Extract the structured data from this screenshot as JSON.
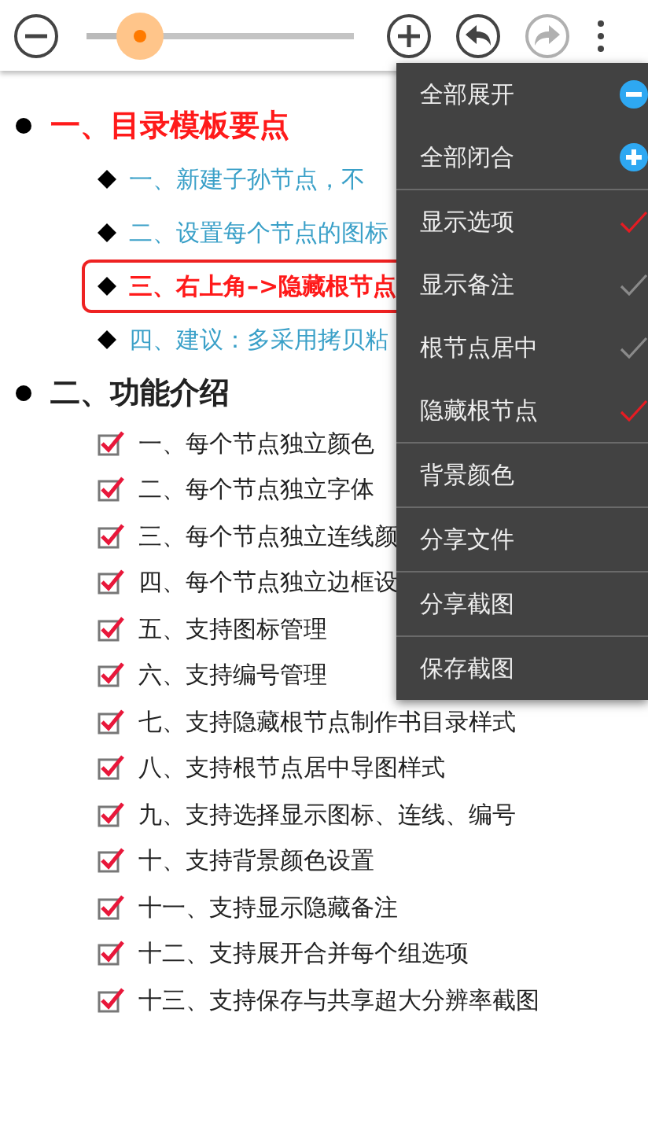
{
  "toolbar": {
    "zoom": {
      "level": 0.2
    },
    "undo": {
      "disabled": false
    },
    "redo": {
      "disabled": true
    }
  },
  "outline": [
    {
      "text": "一、目录模板要点",
      "color": "#ff1a1a",
      "children": [
        {
          "text": "一、新建子孙节点，不",
          "color": "#3aa0c8",
          "highlighted": false
        },
        {
          "text": "二、设置每个节点的图标",
          "color": "#3aa0c8",
          "highlighted": false
        },
        {
          "text": "三、右上角–>隐藏根节点",
          "color": "#ff1a1a",
          "highlighted": true
        },
        {
          "text": "四、建议：多采用拷贝粘",
          "color": "#3aa0c8",
          "highlighted": false
        }
      ]
    },
    {
      "text": "二、功能介绍",
      "color": "#222222",
      "children": [
        {
          "text": "一、每个节点独立颜色",
          "checked": true
        },
        {
          "text": "二、每个节点独立字体",
          "checked": true
        },
        {
          "text": "三、每个节点独立连线颜",
          "checked": true
        },
        {
          "text": "四、每个节点独立边框设",
          "checked": true
        },
        {
          "text": "五、支持图标管理",
          "checked": true
        },
        {
          "text": "六、支持编号管理",
          "checked": true
        },
        {
          "text": "七、支持隐藏根节点制作书目录样式",
          "checked": true
        },
        {
          "text": "八、支持根节点居中导图样式",
          "checked": true
        },
        {
          "text": "九、支持选择显示图标、连线、编号",
          "checked": true
        },
        {
          "text": "十、支持背景颜色设置",
          "checked": true
        },
        {
          "text": "十一、支持显示隐藏备注",
          "checked": true
        },
        {
          "text": "十二、支持展开合并每个组选项",
          "checked": true
        },
        {
          "text": "十三、支持保存与共享超大分辨率截图",
          "checked": true
        }
      ]
    }
  ],
  "menu": [
    {
      "kind": "expand",
      "label": "全部展开"
    },
    {
      "kind": "collapse",
      "label": "全部闭合",
      "divider": true
    },
    {
      "kind": "toggle",
      "label": "显示选项",
      "checked": true
    },
    {
      "kind": "toggle",
      "label": "显示备注",
      "checked": false
    },
    {
      "kind": "toggle",
      "label": "根节点居中",
      "checked": false
    },
    {
      "kind": "toggle",
      "label": "隐藏根节点",
      "checked": true,
      "divider": true
    },
    {
      "kind": "plain",
      "label": "背景颜色",
      "divider": true
    },
    {
      "kind": "plain",
      "label": "分享文件",
      "divider": true
    },
    {
      "kind": "plain",
      "label": "分享截图",
      "divider": true
    },
    {
      "kind": "plain",
      "label": "保存截图"
    }
  ]
}
